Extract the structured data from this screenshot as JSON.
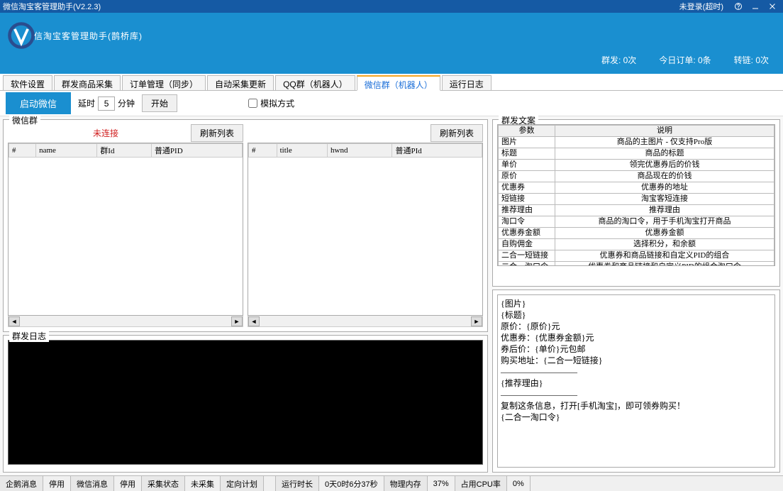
{
  "window": {
    "title": "微信淘宝客管理助手(V2.2.3)",
    "login_status": "未登录(超时)"
  },
  "header": {
    "app_title": "信淘宝客管理助手(鹊桥库)",
    "stats": {
      "qunfa": "群发: 0次",
      "dingdan": "今日订单: 0条",
      "zhuanlian": "转链: 0次"
    }
  },
  "tabs": [
    "软件设置",
    "群发商品采集",
    "订单管理（同步）",
    "自动采集更新",
    "QQ群（机器人）",
    "微信群（机器人）",
    "运行日志"
  ],
  "active_tab": 5,
  "toolbar": {
    "start_weixin": "启动微信",
    "delay_label": "延时",
    "delay_value": "5",
    "delay_unit": "分钟",
    "start_label": "开始",
    "simulate_label": "模拟方式"
  },
  "weixin_group": {
    "title": "微信群",
    "status": "未连接",
    "refresh": "刷新列表",
    "cols_left": [
      "#",
      "name",
      "群Id",
      "普通PID"
    ],
    "cols_right": [
      "#",
      "title",
      "hwnd",
      "普通PId"
    ]
  },
  "log_group": {
    "title": "群发日志"
  },
  "template_group": {
    "title": "群发文案",
    "headers": [
      "参数",
      "说明"
    ],
    "rows": [
      [
        "图片",
        "商品的主图片 - 仅支持Pro版"
      ],
      [
        "标题",
        "商品的标题"
      ],
      [
        "单价",
        "领完优惠券后的价钱"
      ],
      [
        "原价",
        "商品现在的价钱"
      ],
      [
        "优惠券",
        "优惠券的地址"
      ],
      [
        "短链接",
        "淘宝客短连接"
      ],
      [
        "推荐理由",
        "推荐理由"
      ],
      [
        "淘口令",
        "商品的淘口令，用于手机淘宝打开商品"
      ],
      [
        "优惠券金额",
        "优惠券金额"
      ],
      [
        "自购佣金",
        "选择积分，和余额"
      ],
      [
        "二合一短链接",
        "优惠券和商品链接和自定义PID的组合"
      ],
      [
        "二合一淘口令",
        "优惠券和商品链接和自定义PID的组合淘口令"
      ]
    ],
    "template": "{图片}\n{标题}\n原价：{原价}元\n优惠券：{优惠券金额}元\n券后价：{单价}元包邮\n购买地址：{二合一短链接}\n—————————\n{推荐理由}\n—————————\n复制这条信息，打开[手机淘宝]，即可领券购买！\n{二合一淘口令}"
  },
  "status_bar": {
    "items": [
      {
        "label": "企鹅消息",
        "value": "停用"
      },
      {
        "label": "微信消息",
        "value": "停用"
      },
      {
        "label": "采集状态",
        "value": "未采集"
      },
      {
        "label": "定向计划",
        "value": ""
      },
      {
        "label": "运行时长",
        "value": "0天0时6分37秒"
      },
      {
        "label": "物理内存",
        "value": "37%"
      },
      {
        "label": "占用CPU率",
        "value": "0%"
      }
    ]
  }
}
